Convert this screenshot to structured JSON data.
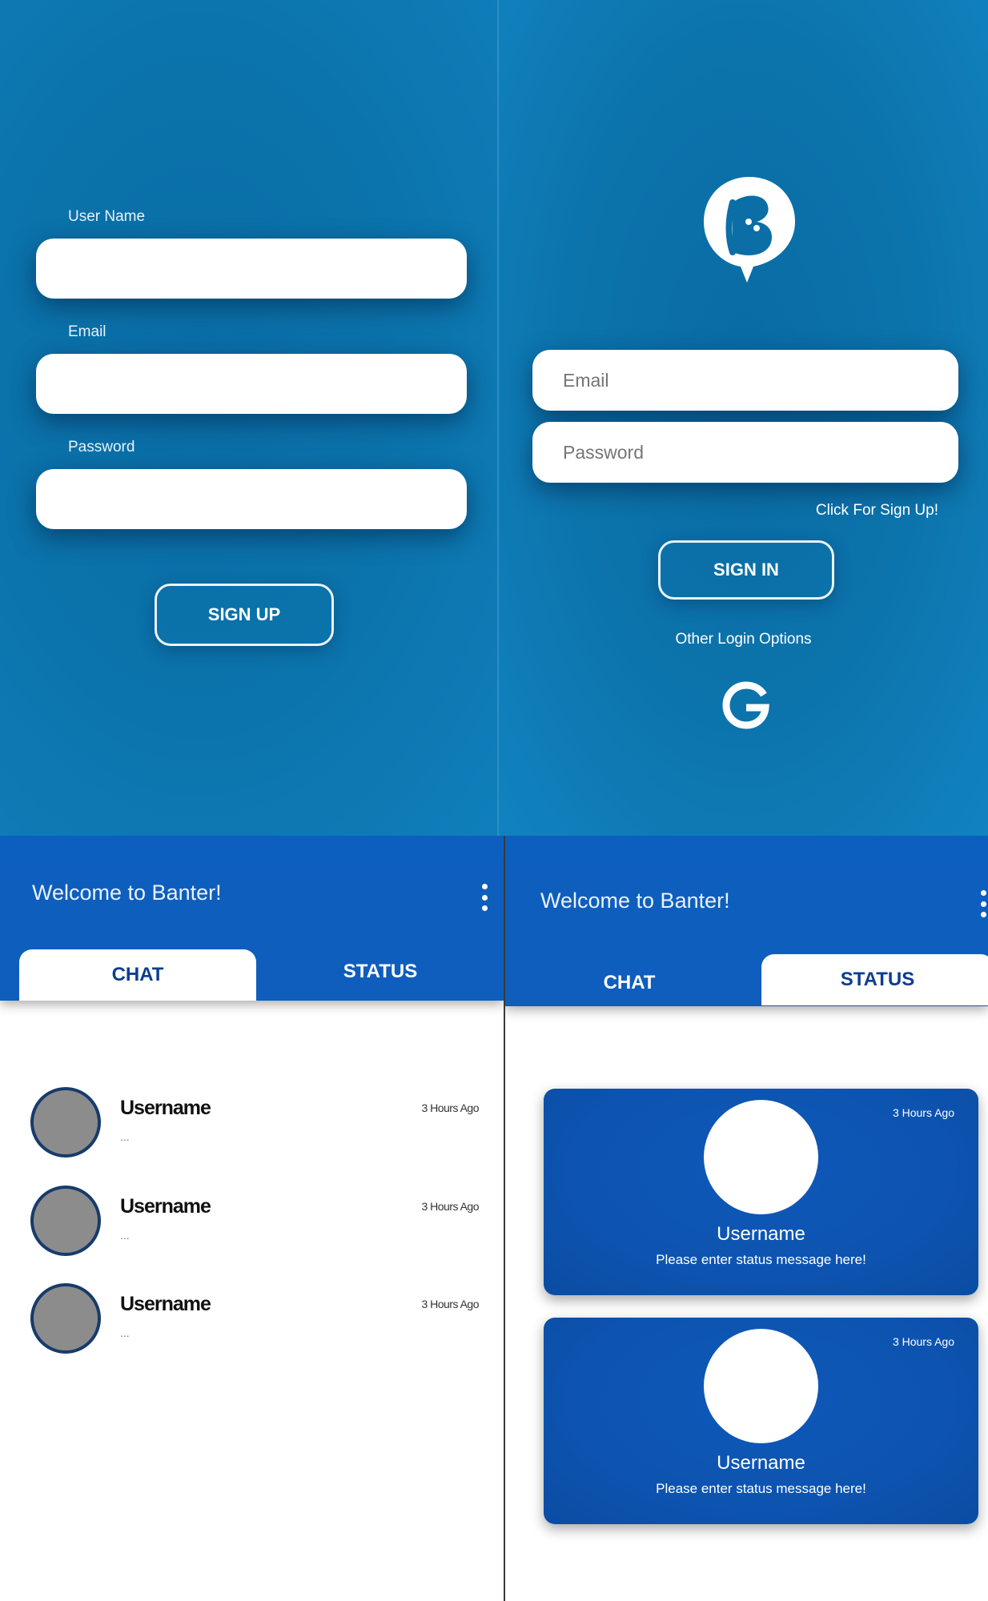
{
  "signup": {
    "username_label": "User Name",
    "email_label": "Email",
    "password_label": "Password",
    "button_label": "SIGN UP"
  },
  "signin": {
    "email_placeholder": "Email",
    "password_placeholder": "Password",
    "signup_link": "Click For Sign Up!",
    "button_label": "SIGN IN",
    "other_options": "Other Login Options",
    "logo_icon": "banter-logo-icon",
    "google_icon": "google-icon"
  },
  "chat_screen": {
    "title": "Welcome to Banter!",
    "tabs": {
      "chat": "CHAT",
      "status": "STATUS"
    },
    "active_tab": "chat",
    "items": [
      {
        "name": "Username",
        "preview": "...",
        "time": "3 Hours Ago"
      },
      {
        "name": "Username",
        "preview": "...",
        "time": "3 Hours Ago"
      },
      {
        "name": "Username",
        "preview": "...",
        "time": "3 Hours Ago"
      }
    ]
  },
  "status_screen": {
    "title": "Welcome to Banter!",
    "tabs": {
      "chat": "CHAT",
      "status": "STATUS"
    },
    "active_tab": "status",
    "cards": [
      {
        "name": "Username",
        "message": "Please enter status message here!",
        "time": "3 Hours Ago"
      },
      {
        "name": "Username",
        "message": "Please enter status message here!",
        "time": "3 Hours Ago"
      }
    ]
  },
  "colors": {
    "auth_background": "#0b72aa",
    "header_blue": "#0f5dbd",
    "tab_active_text": "#0d3d8f",
    "avatar_gray": "#8c8c8c",
    "avatar_border": "#173b6b"
  }
}
